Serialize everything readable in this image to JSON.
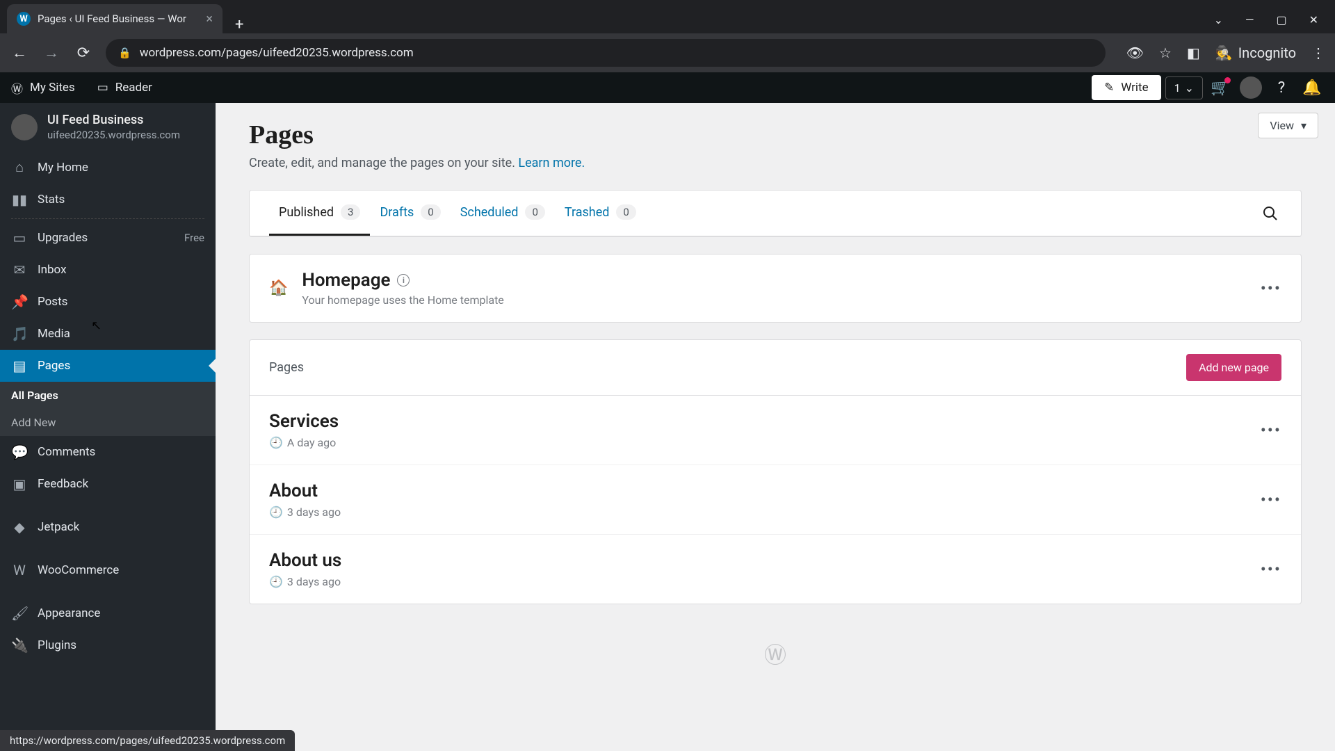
{
  "browser": {
    "tab_title": "Pages ‹ UI Feed Business — Wor",
    "url": "wordpress.com/pages/uifeed20235.wordpress.com",
    "incognito": "Incognito"
  },
  "wp_bar": {
    "my_sites": "My Sites",
    "reader": "Reader",
    "write": "Write",
    "count": "1"
  },
  "site": {
    "name": "UI Feed Business",
    "url": "uifeed20235.wordpress.com"
  },
  "sidebar": {
    "my_home": "My Home",
    "stats": "Stats",
    "upgrades": "Upgrades",
    "upgrades_badge": "Free",
    "inbox": "Inbox",
    "posts": "Posts",
    "media": "Media",
    "pages": "Pages",
    "all_pages": "All Pages",
    "add_new": "Add New",
    "comments": "Comments",
    "feedback": "Feedback",
    "jetpack": "Jetpack",
    "woocommerce": "WooCommerce",
    "appearance": "Appearance",
    "plugins": "Plugins"
  },
  "main": {
    "view": "View",
    "title": "Pages",
    "description": "Create, edit, and manage the pages on your site. ",
    "learn_more": "Learn more.",
    "tabs": {
      "published": "Published",
      "published_count": "3",
      "drafts": "Drafts",
      "drafts_count": "0",
      "scheduled": "Scheduled",
      "scheduled_count": "0",
      "trashed": "Trashed",
      "trashed_count": "0"
    },
    "homepage": {
      "title": "Homepage",
      "sub": "Your homepage uses the Home template"
    },
    "list_header": "Pages",
    "add_new_page": "Add new page",
    "pages": [
      {
        "title": "Services",
        "meta": "A day ago"
      },
      {
        "title": "About",
        "meta": "3 days ago"
      },
      {
        "title": "About us",
        "meta": "3 days ago"
      }
    ]
  },
  "status_bar": "https://wordpress.com/pages/uifeed20235.wordpress.com"
}
